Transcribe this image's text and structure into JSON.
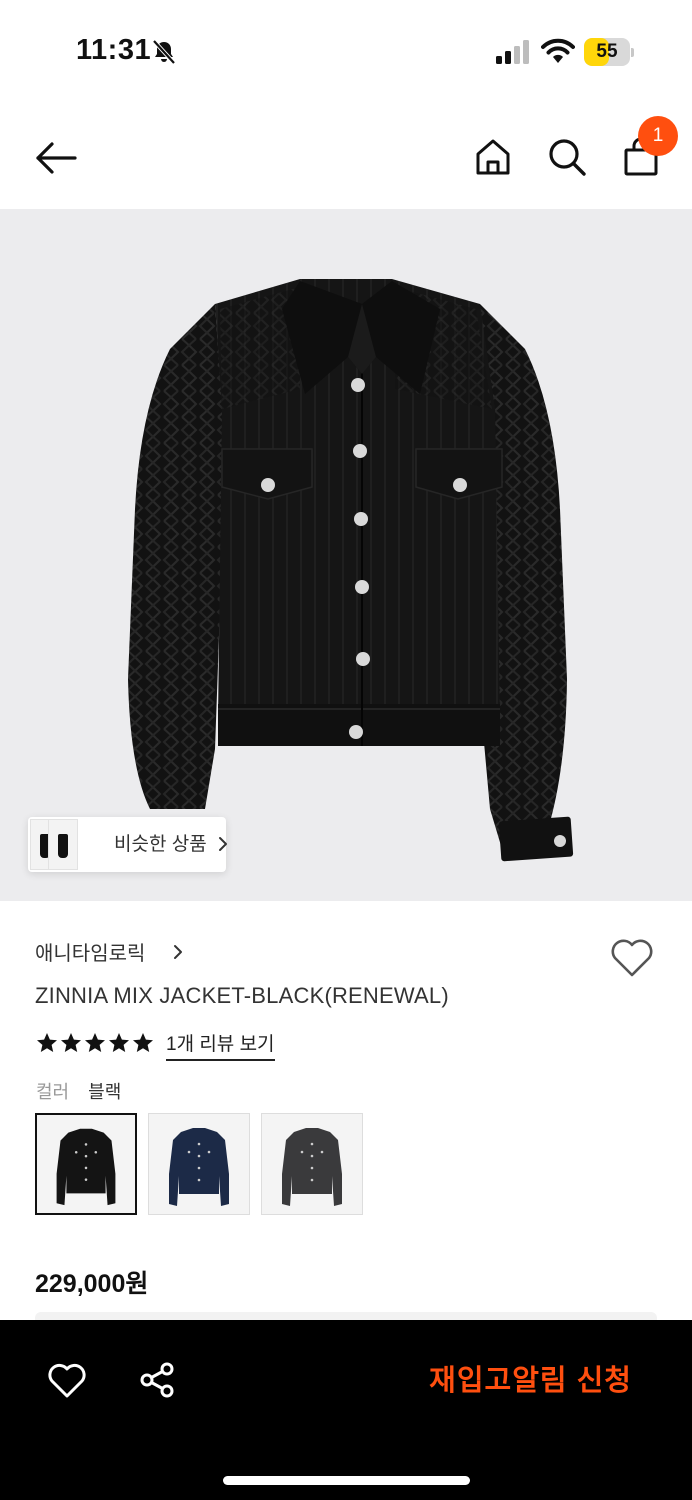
{
  "status_bar": {
    "time": "11:31",
    "battery": "55",
    "battery_level": 0.55,
    "icons": [
      "bell-off-icon",
      "signal-icon",
      "wifi-icon",
      "battery-icon"
    ]
  },
  "top_nav": {
    "icons": [
      "back-arrow-icon",
      "home-icon",
      "search-icon",
      "shopping-bag-icon"
    ],
    "cart_badge": "1",
    "accent_color": "#ff4f0f"
  },
  "hero": {
    "image": "black-cable-knit-denim-jacket",
    "similar_label": "비슷한 상품"
  },
  "product": {
    "brand": "애니타임로릭",
    "name": "ZINNIA MIX JACKET-BLACK(RENEWAL)",
    "rating": 5,
    "review_link": "1개 리뷰 보기",
    "color_label": "컬러",
    "color_value": "블랙",
    "swatches": [
      {
        "name": "black",
        "color": "#141414",
        "selected": true
      },
      {
        "name": "navy",
        "color": "#1c2a47",
        "selected": false
      },
      {
        "name": "charcoal",
        "color": "#3a3a3c",
        "selected": false
      }
    ],
    "price": "229,000원"
  },
  "bottom_bar": {
    "icons": [
      "heart-icon",
      "share-icon"
    ],
    "restock_label": "재입고알림 신청",
    "accent_color": "#ff4f0f"
  }
}
